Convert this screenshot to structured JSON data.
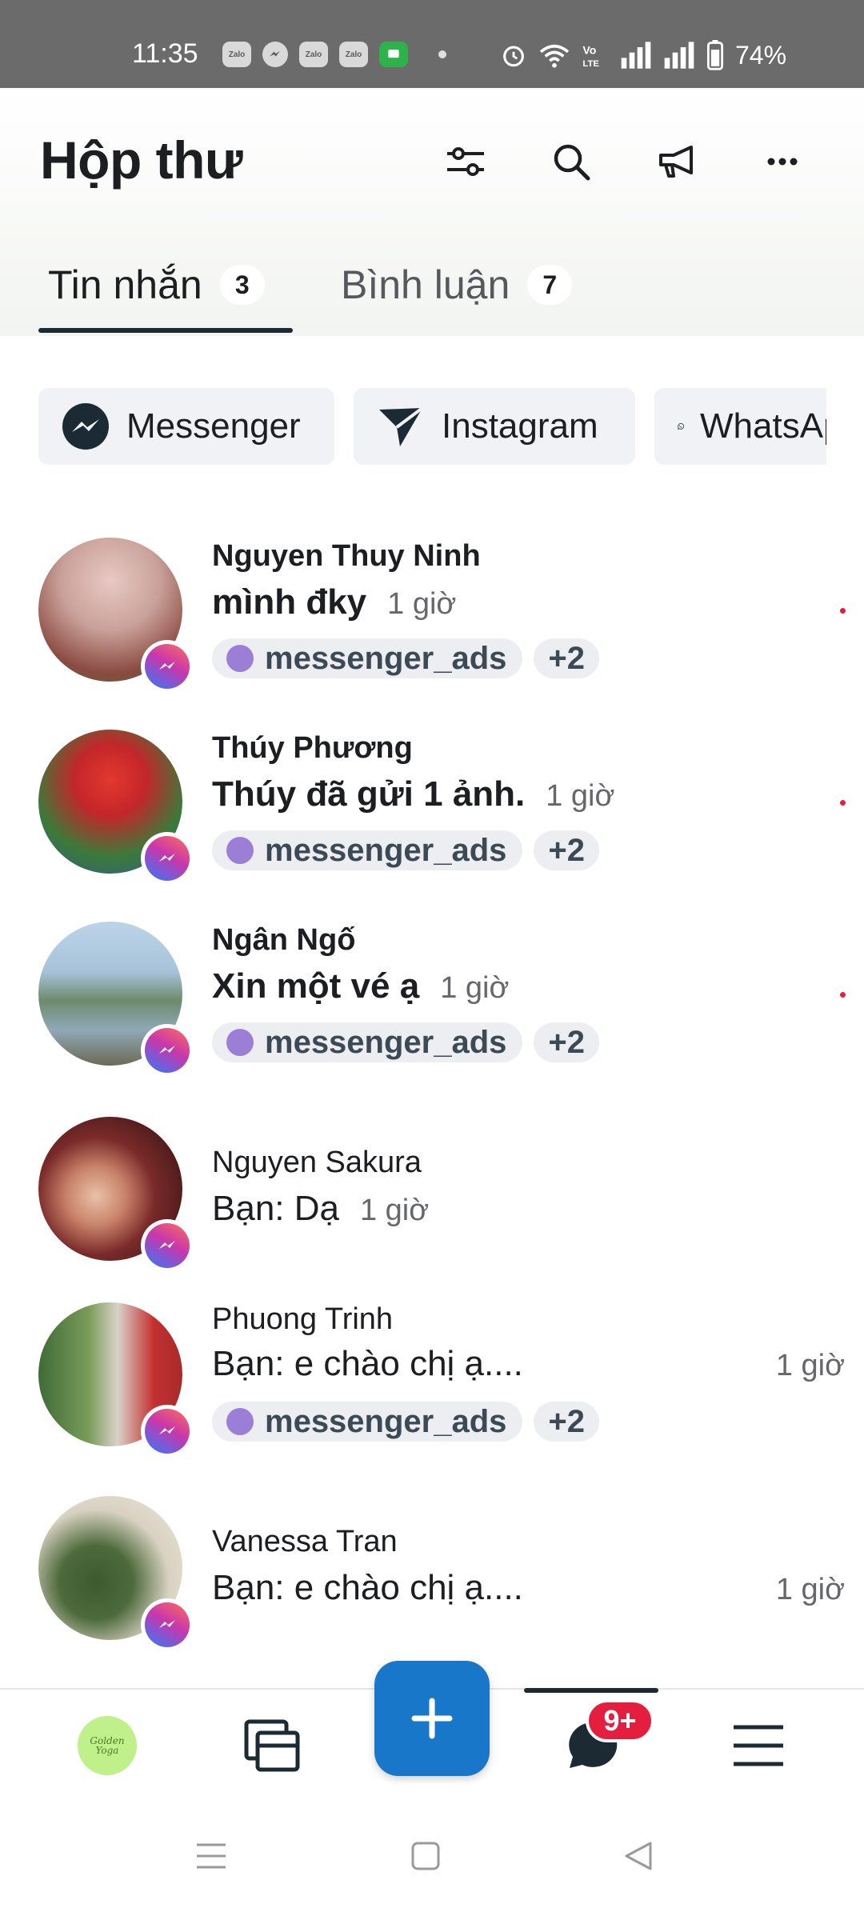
{
  "status_bar": {
    "time": "11:35",
    "app_icons": [
      "Zalo",
      "messenger-icon",
      "Zalo",
      "Zalo",
      "chat-icon"
    ],
    "battery": "74%"
  },
  "header": {
    "title": "Hộp thư",
    "icons": [
      "filter-icon",
      "search-icon",
      "megaphone-icon",
      "more-icon"
    ]
  },
  "tabs": [
    {
      "label": "Tin nhắn",
      "count": "3",
      "active": true
    },
    {
      "label": "Bình luận",
      "count": "7",
      "active": false
    }
  ],
  "channels": [
    {
      "label": "Messenger",
      "icon": "messenger-icon"
    },
    {
      "label": "Instagram",
      "icon": "instagram-direct-icon"
    },
    {
      "label": "WhatsApp",
      "icon": "whatsapp-icon"
    }
  ],
  "conversations": [
    {
      "name": "Nguyen Thuy Ninh",
      "preview": "mình đky",
      "time": "1 giờ",
      "unread": true,
      "tag": "messenger_ads",
      "more": "+2"
    },
    {
      "name": "Thúy Phương",
      "preview": "Thúy đã gửi 1 ảnh.",
      "time": "1 giờ",
      "unread": true,
      "tag": "messenger_ads",
      "more": "+2"
    },
    {
      "name": "Ngân Ngố",
      "preview": "Xin một vé ạ",
      "time": "1 giờ",
      "unread": true,
      "tag": "messenger_ads",
      "more": "+2"
    },
    {
      "name": "Nguyen Sakura",
      "preview": "Bạn: Dạ",
      "time": "1 giờ",
      "unread": false
    },
    {
      "name": "Phuong Trinh",
      "preview": "Bạn: e chào chị ạ....",
      "time": "1 giờ",
      "unread": false,
      "tag": "messenger_ads",
      "more": "+2"
    },
    {
      "name": "Vanessa Tran",
      "preview": "Bạn: e chào chị ạ....",
      "time": "1 giờ",
      "unread": false
    }
  ],
  "bottom_nav": {
    "brand": "Golden Yoga",
    "inbox_badge": "9+",
    "icons": [
      "posts-icon",
      "create-icon",
      "inbox-icon",
      "menu-icon"
    ]
  },
  "colors": {
    "accent": "#1877c8",
    "unread": "#e41e3f",
    "tag_dot": "#9b7fd6"
  }
}
